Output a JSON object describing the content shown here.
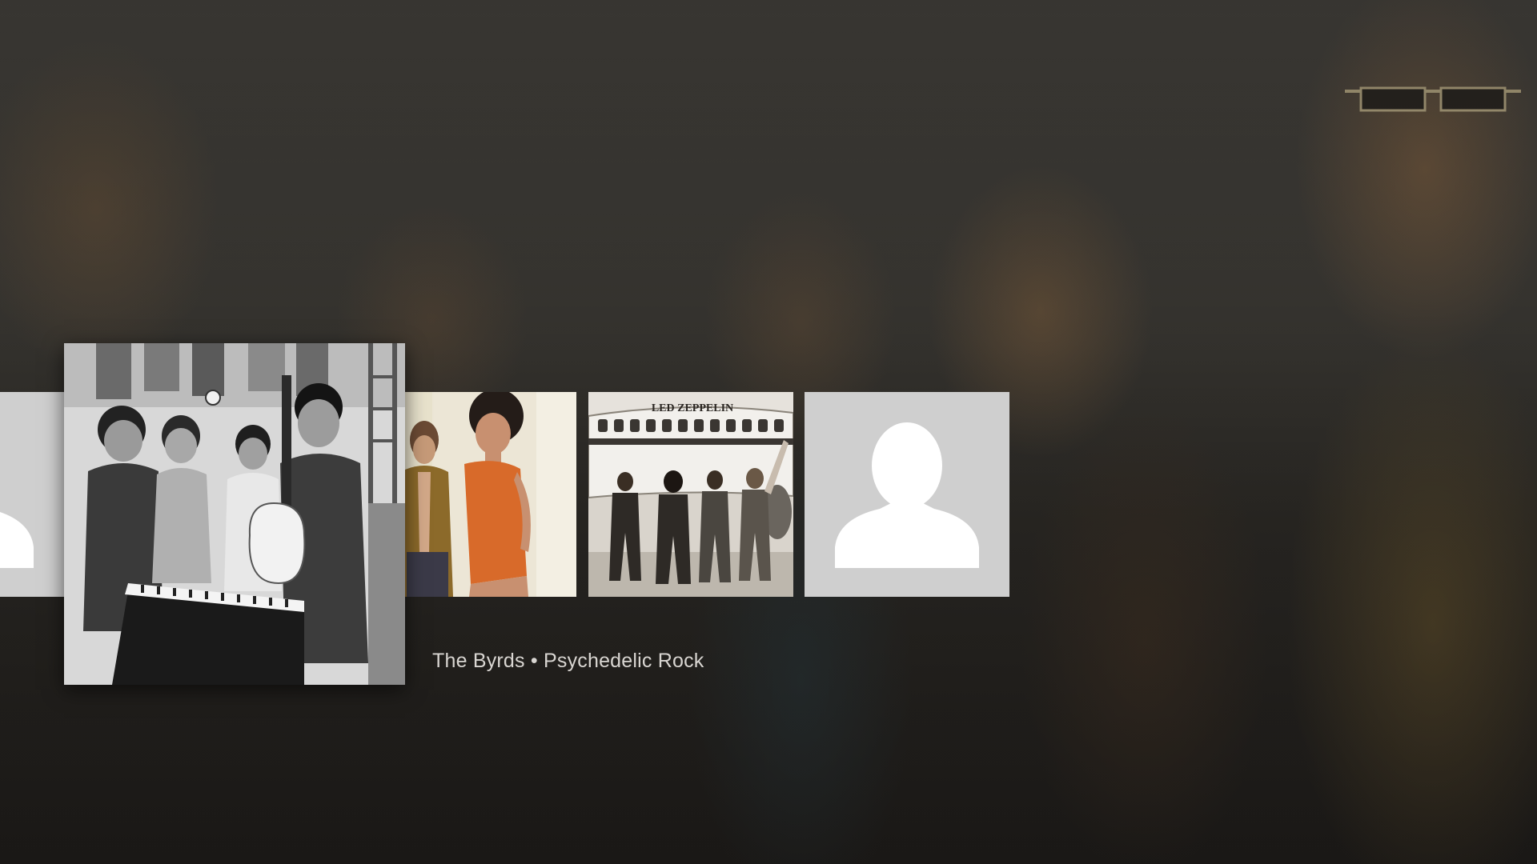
{
  "app": {
    "background": "The Byrds backdrop photo"
  },
  "carousel": {
    "focused_index": 1,
    "items": [
      {
        "kind": "placeholder",
        "icon": "person-silhouette-icon"
      },
      {
        "kind": "photo",
        "subject": "The Byrds",
        "style": "black-and-white"
      },
      {
        "kind": "photo",
        "subject": "two people",
        "style": "color"
      },
      {
        "kind": "photo",
        "subject": "Led Zeppelin with airplane",
        "style": "sepia"
      },
      {
        "kind": "placeholder",
        "icon": "person-silhouette-icon"
      }
    ],
    "plane_lettering": "LED ZEPPELIN"
  },
  "caption": {
    "artist": "The Byrds",
    "separator": "•",
    "genre": "Psychedelic Rock",
    "full": "The Byrds • Psychedelic Rock"
  },
  "colors": {
    "placeholder_bg": "#cfcfcf",
    "placeholder_icon": "#ffffff",
    "caption_text": "#d9d6d2"
  }
}
